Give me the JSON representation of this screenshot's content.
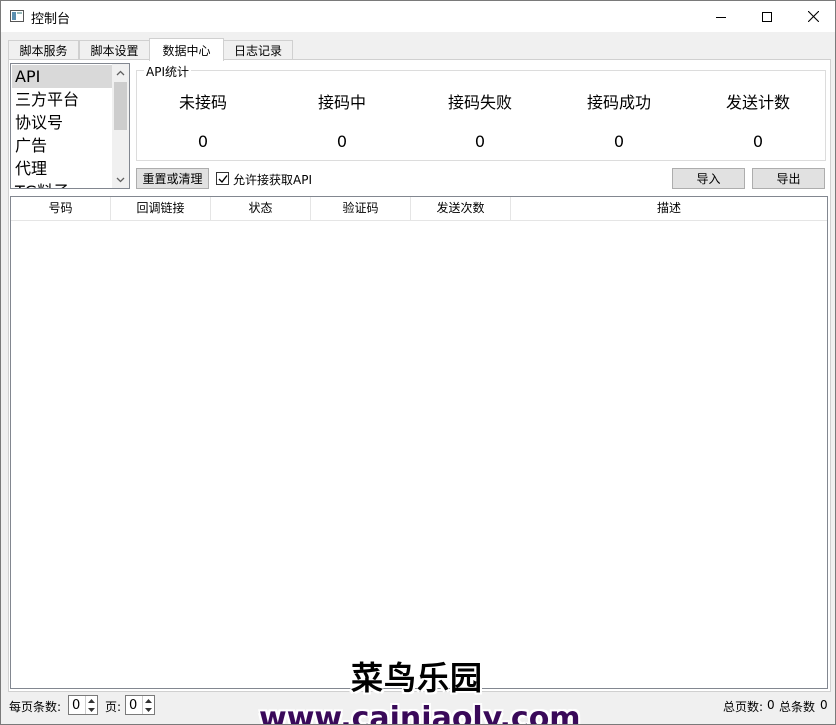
{
  "window": {
    "title": "控制台"
  },
  "tabs": [
    {
      "label": "脚本服务"
    },
    {
      "label": "脚本设置"
    },
    {
      "label": "数据中心",
      "active": true
    },
    {
      "label": "日志记录"
    }
  ],
  "sidebar": {
    "items": [
      {
        "label": "API",
        "selected": true
      },
      {
        "label": "三方平台"
      },
      {
        "label": "协议号"
      },
      {
        "label": "广告"
      },
      {
        "label": "代理"
      },
      {
        "label": "TG料子"
      }
    ]
  },
  "api_stats": {
    "group_title": "API统计",
    "labels": [
      "未接码",
      "接码中",
      "接码失败",
      "接码成功",
      "发送计数"
    ],
    "values": [
      "0",
      "0",
      "0",
      "0",
      "0"
    ]
  },
  "toolbar": {
    "reset_label": "重置或清理",
    "allow_api_label": "允许接获取API",
    "allow_api_checked": true,
    "import_label": "导入",
    "export_label": "导出"
  },
  "table": {
    "columns": [
      "号码",
      "回调链接",
      "状态",
      "验证码",
      "发送次数",
      "描述"
    ],
    "rows": []
  },
  "footer": {
    "per_page_label": "每页条数:",
    "per_page_value": "0",
    "page_label": "页:",
    "page_value": "0",
    "total_pages_label": "总页数:",
    "total_pages_value": "0",
    "total_items_label": "总条数",
    "total_items_value": "0"
  },
  "watermark": {
    "text": "菜鸟乐园",
    "url": "www.cainiaoly.com"
  }
}
